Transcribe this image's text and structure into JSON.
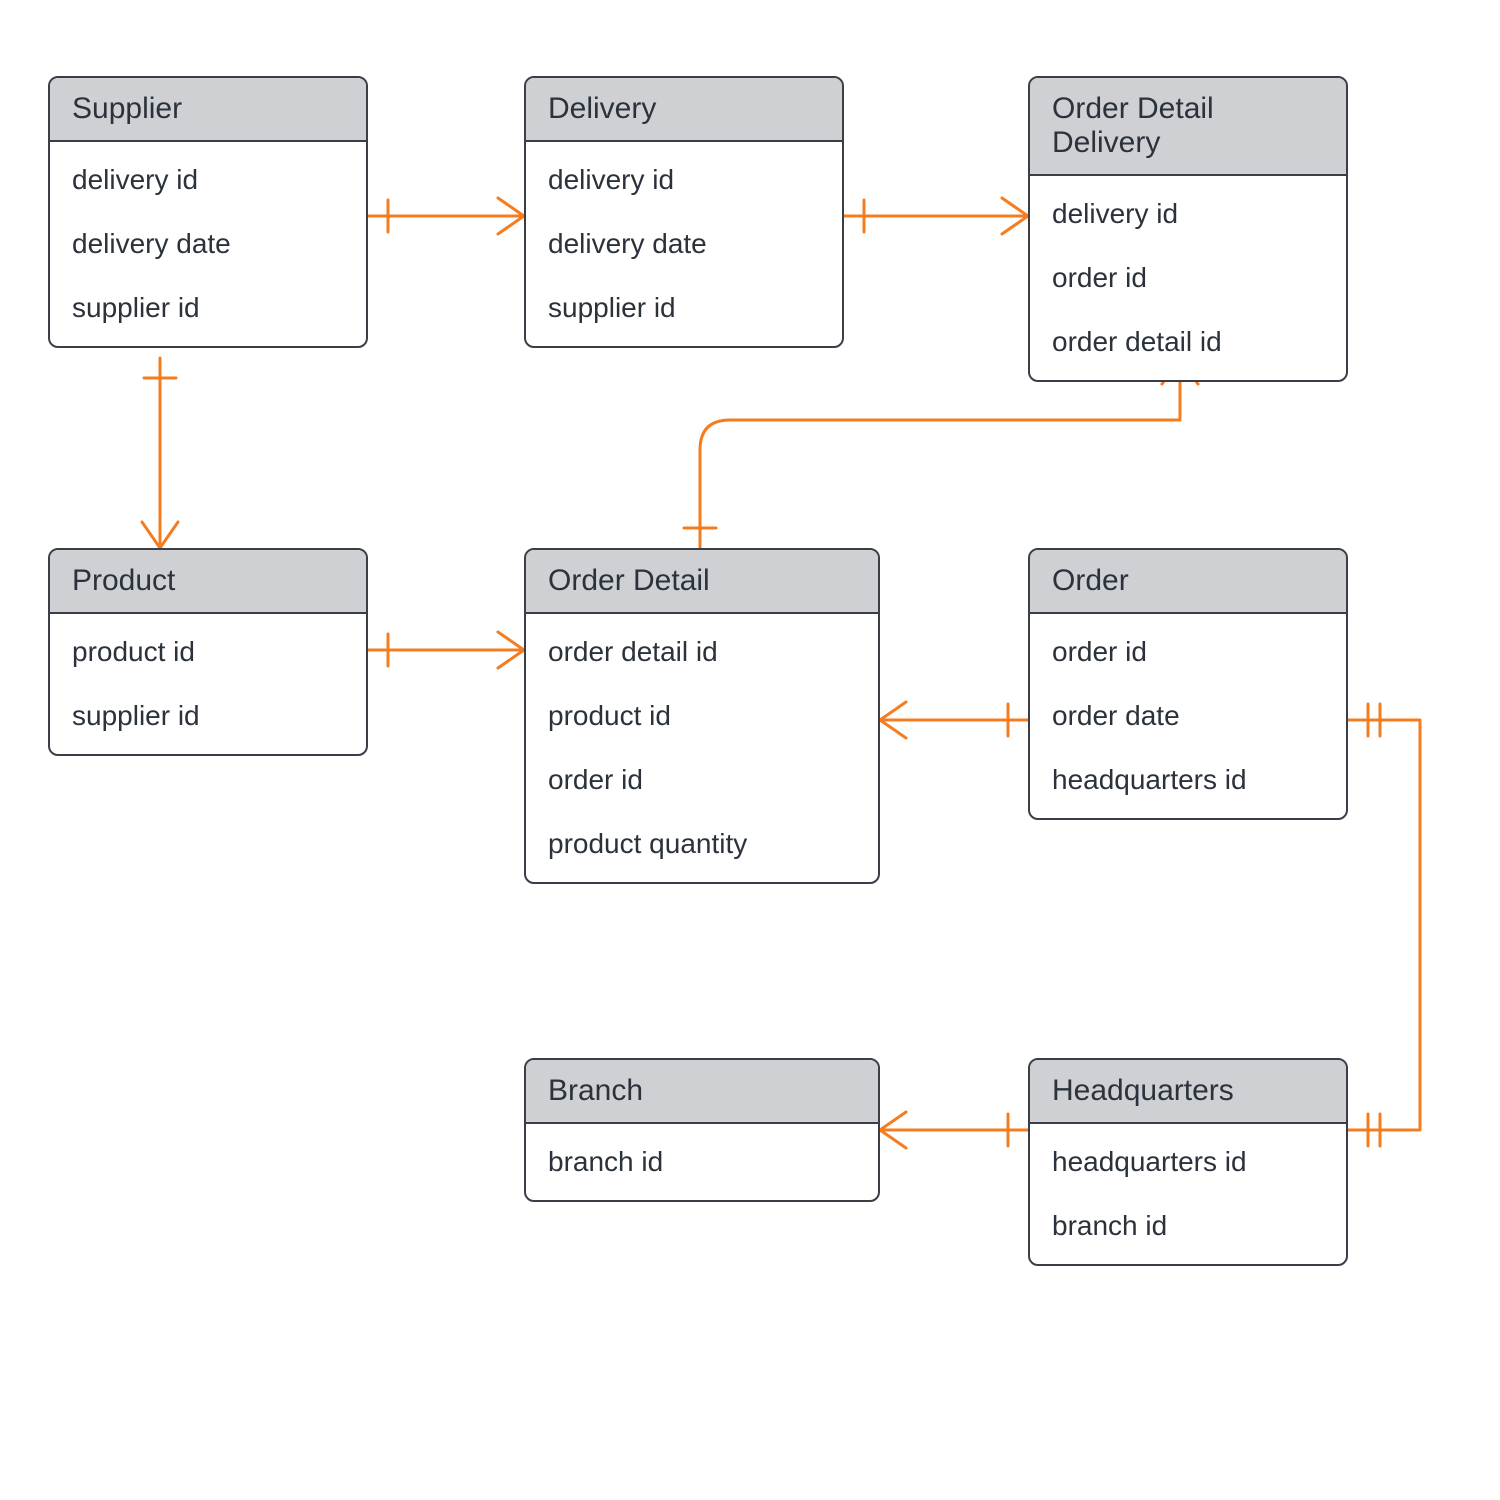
{
  "diagram_type": "entity-relationship",
  "accent_color": "#f57c1f",
  "entities": {
    "supplier": {
      "title": "Supplier",
      "attrs": [
        "delivery id",
        "delivery date",
        "supplier id"
      ]
    },
    "delivery": {
      "title": "Delivery",
      "attrs": [
        "delivery id",
        "delivery date",
        "supplier id"
      ]
    },
    "order_detail_delivery": {
      "title": "Order Detail Delivery",
      "attrs": [
        "delivery id",
        "order id",
        "order detail id"
      ]
    },
    "product": {
      "title": "Product",
      "attrs": [
        "product id",
        "supplier id"
      ]
    },
    "order_detail": {
      "title": "Order Detail",
      "attrs": [
        "order detail id",
        "product id",
        "order id",
        "product quantity"
      ]
    },
    "order": {
      "title": "Order",
      "attrs": [
        "order id",
        "order date",
        "headquarters id"
      ]
    },
    "branch": {
      "title": "Branch",
      "attrs": [
        "branch id"
      ]
    },
    "headquarters": {
      "title": "Headquarters",
      "attrs": [
        "headquarters id",
        "branch id"
      ]
    }
  },
  "relationships": [
    {
      "from": "supplier",
      "to": "delivery",
      "type": "one-to-many"
    },
    {
      "from": "delivery",
      "to": "order_detail_delivery",
      "type": "one-to-many"
    },
    {
      "from": "supplier",
      "to": "product",
      "type": "one-to-many"
    },
    {
      "from": "product",
      "to": "order_detail",
      "type": "one-to-many"
    },
    {
      "from": "order_detail",
      "to": "order_detail_delivery",
      "type": "one-to-many"
    },
    {
      "from": "order",
      "to": "order_detail",
      "type": "one-to-many"
    },
    {
      "from": "headquarters",
      "to": "order",
      "type": "one-to-one"
    },
    {
      "from": "headquarters",
      "to": "branch",
      "type": "one-to-many"
    }
  ]
}
